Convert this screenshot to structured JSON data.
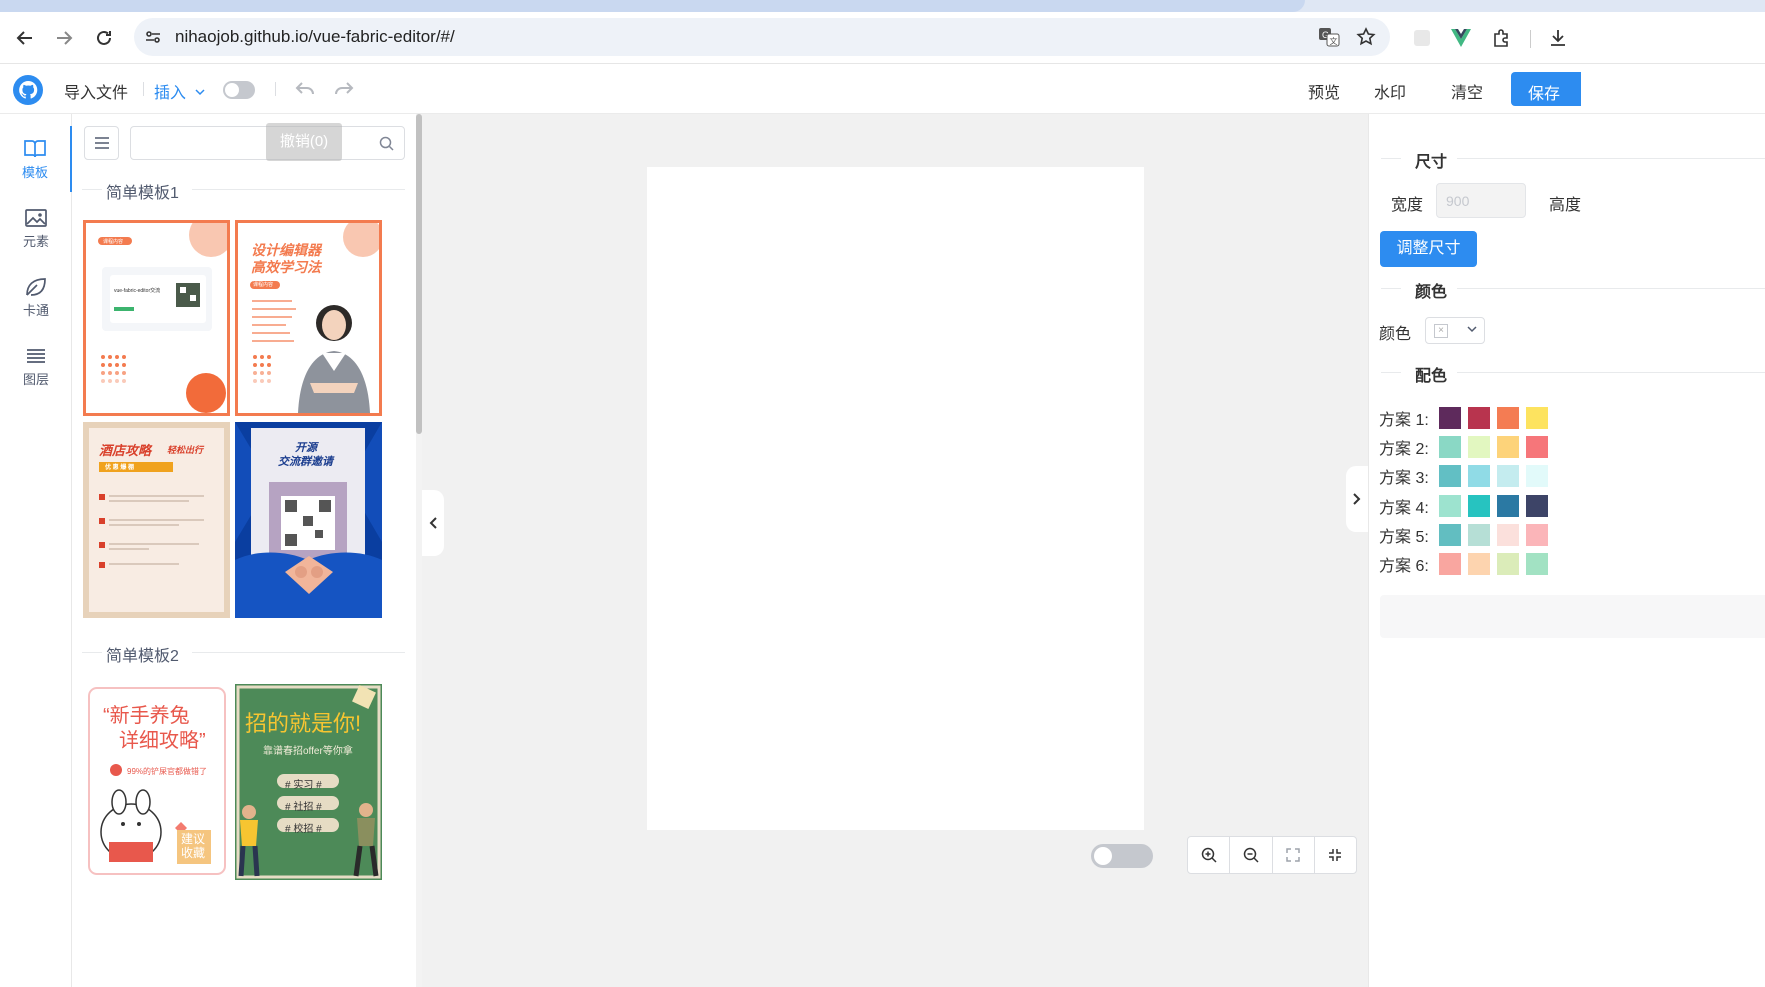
{
  "browser": {
    "url": "nihaojob.github.io/vue-fabric-editor/#/"
  },
  "header": {
    "import_label": "导入文件",
    "insert_label": "插入",
    "undo_tooltip": "撤销(0)",
    "preview_label": "预览",
    "watermark_label": "水印",
    "clear_label": "清空",
    "save_label": "保存"
  },
  "sidebar": {
    "items": [
      {
        "label": "模板",
        "icon": "book-icon",
        "active": true
      },
      {
        "label": "元素",
        "icon": "image-icon",
        "active": false
      },
      {
        "label": "卡通",
        "icon": "leaf-icon",
        "active": false
      },
      {
        "label": "图层",
        "icon": "layers-icon",
        "active": false
      }
    ]
  },
  "templates": {
    "group1_title": "简单模板1",
    "group2_title": "简单模板2",
    "cards": {
      "c2_title_line1": "设计编辑器",
      "c2_title_line2": "高效学习法",
      "c2_badge": "课程内容",
      "c1_badge": "课程内容",
      "c1_card_text": "vue-fabric-editor交流",
      "c3_title": "酒店攻略",
      "c3_sub": "轻松出行",
      "c3_tag": "优 惠 爆 棚",
      "c4_title_line1": "开源",
      "c4_title_line2": "交流群邀请",
      "c5_title_line1": "“新手养兔",
      "c5_title_line2": "详细攻略”",
      "c5_sub": "99%的铲屎官都做错了",
      "c5_corner": "建议收藏",
      "c6_title": "招的就是你!",
      "c6_sub": "靠谱春招offer等你拿",
      "c6_tag1": "# 实习 #",
      "c6_tag2": "# 社招 #",
      "c6_tag3": "# 校招 #"
    }
  },
  "right_panel": {
    "size_title": "尺寸",
    "width_label": "宽度",
    "width_value": "900",
    "height_label": "高度",
    "resize_button": "调整尺寸",
    "color_title": "颜色",
    "color_label": "颜色",
    "palette_title": "配色",
    "schemes": [
      {
        "name": "方案 1:",
        "colors": [
          "#5e2a5c",
          "#b8344e",
          "#f47c53",
          "#fde35f"
        ]
      },
      {
        "name": "方案 2:",
        "colors": [
          "#8ad8c5",
          "#e2f7c0",
          "#fdd37a",
          "#f6767a"
        ]
      },
      {
        "name": "方案 3:",
        "colors": [
          "#62bfc4",
          "#90dbe6",
          "#c4ecef",
          "#e2fafa"
        ]
      },
      {
        "name": "方案 4:",
        "colors": [
          "#9de3cf",
          "#27c3c0",
          "#2b79a3",
          "#3d4467"
        ]
      },
      {
        "name": "方案 5:",
        "colors": [
          "#62bec1",
          "#b6dfd6",
          "#fbe0dc",
          "#fbb5b9"
        ]
      },
      {
        "name": "方案 6:",
        "colors": [
          "#f9a6a0",
          "#fdd4af",
          "#dbecb9",
          "#a2e2c3"
        ]
      }
    ]
  }
}
